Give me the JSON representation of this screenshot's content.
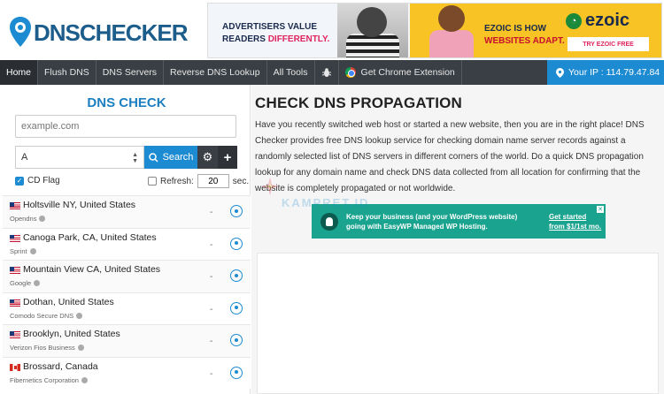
{
  "logo": {
    "part1": "DNS",
    "part2": "CHECKER"
  },
  "top_ad": {
    "left_line1": "ADVERTISERS VALUE",
    "left_line2a": "READERS ",
    "left_line2b": "DIFFERENTLY.",
    "right_line1": "EZOIC IS HOW",
    "right_line2": "WEBSITES ADAPT.",
    "brand": "ezoic",
    "cta": "TRY EZOIC FREE"
  },
  "nav": {
    "items": [
      "Home",
      "Flush DNS",
      "DNS Servers",
      "Reverse DNS Lookup",
      "All Tools"
    ],
    "bug_icon": "bug-icon",
    "extension": "Get Chrome Extension",
    "ip_label": "Your IP : 114.79.47.84"
  },
  "left": {
    "title": "DNS CHECK",
    "domain_placeholder": "example.com",
    "record_type": "A",
    "search_label": "Search",
    "cd_flag": "CD Flag",
    "refresh_label": "Refresh:",
    "refresh_value": "20",
    "refresh_unit": "sec."
  },
  "servers": [
    {
      "location": "Holtsville NY, United States",
      "provider": "Opendns",
      "flag": "us",
      "result": "-"
    },
    {
      "location": "Canoga Park, CA, United States",
      "provider": "Sprint",
      "flag": "us",
      "result": "-"
    },
    {
      "location": "Mountain View CA, United States",
      "provider": "Google",
      "flag": "us",
      "result": "-"
    },
    {
      "location": "Dothan, United States",
      "provider": "Comodo Secure DNS",
      "flag": "us",
      "result": "-"
    },
    {
      "location": "Brooklyn, United States",
      "provider": "Verizon Fios Business",
      "flag": "us",
      "result": "-"
    },
    {
      "location": "Brossard, Canada",
      "provider": "Fibernetics Corporation",
      "flag": "ca",
      "result": "-"
    }
  ],
  "right": {
    "title": "CHECK DNS PROPAGATION",
    "description": "Have you recently switched web host or started a new website, then you are in the right place! DNS Checker provides free DNS lookup service for checking domain name server records against a randomly selected list of DNS servers in different corners of the world. Do a quick DNS propagation lookup for any domain name and check DNS data collected from all location for confirming that the website is completely propagated or not worldwide."
  },
  "mid_ad": {
    "text": "Keep your business (and your WordPress website) going with EasyWP Managed WP Hosting.",
    "cta_line1": "Get started",
    "cta_line2": "from $1/1st mo."
  },
  "watermark": "KAMPRET.ID",
  "colors": {
    "accent": "#1d8bd1",
    "nav_bg": "#3a3f45",
    "ad_teal": "#1aa38f",
    "ezoic_yellow": "#f7c325"
  }
}
